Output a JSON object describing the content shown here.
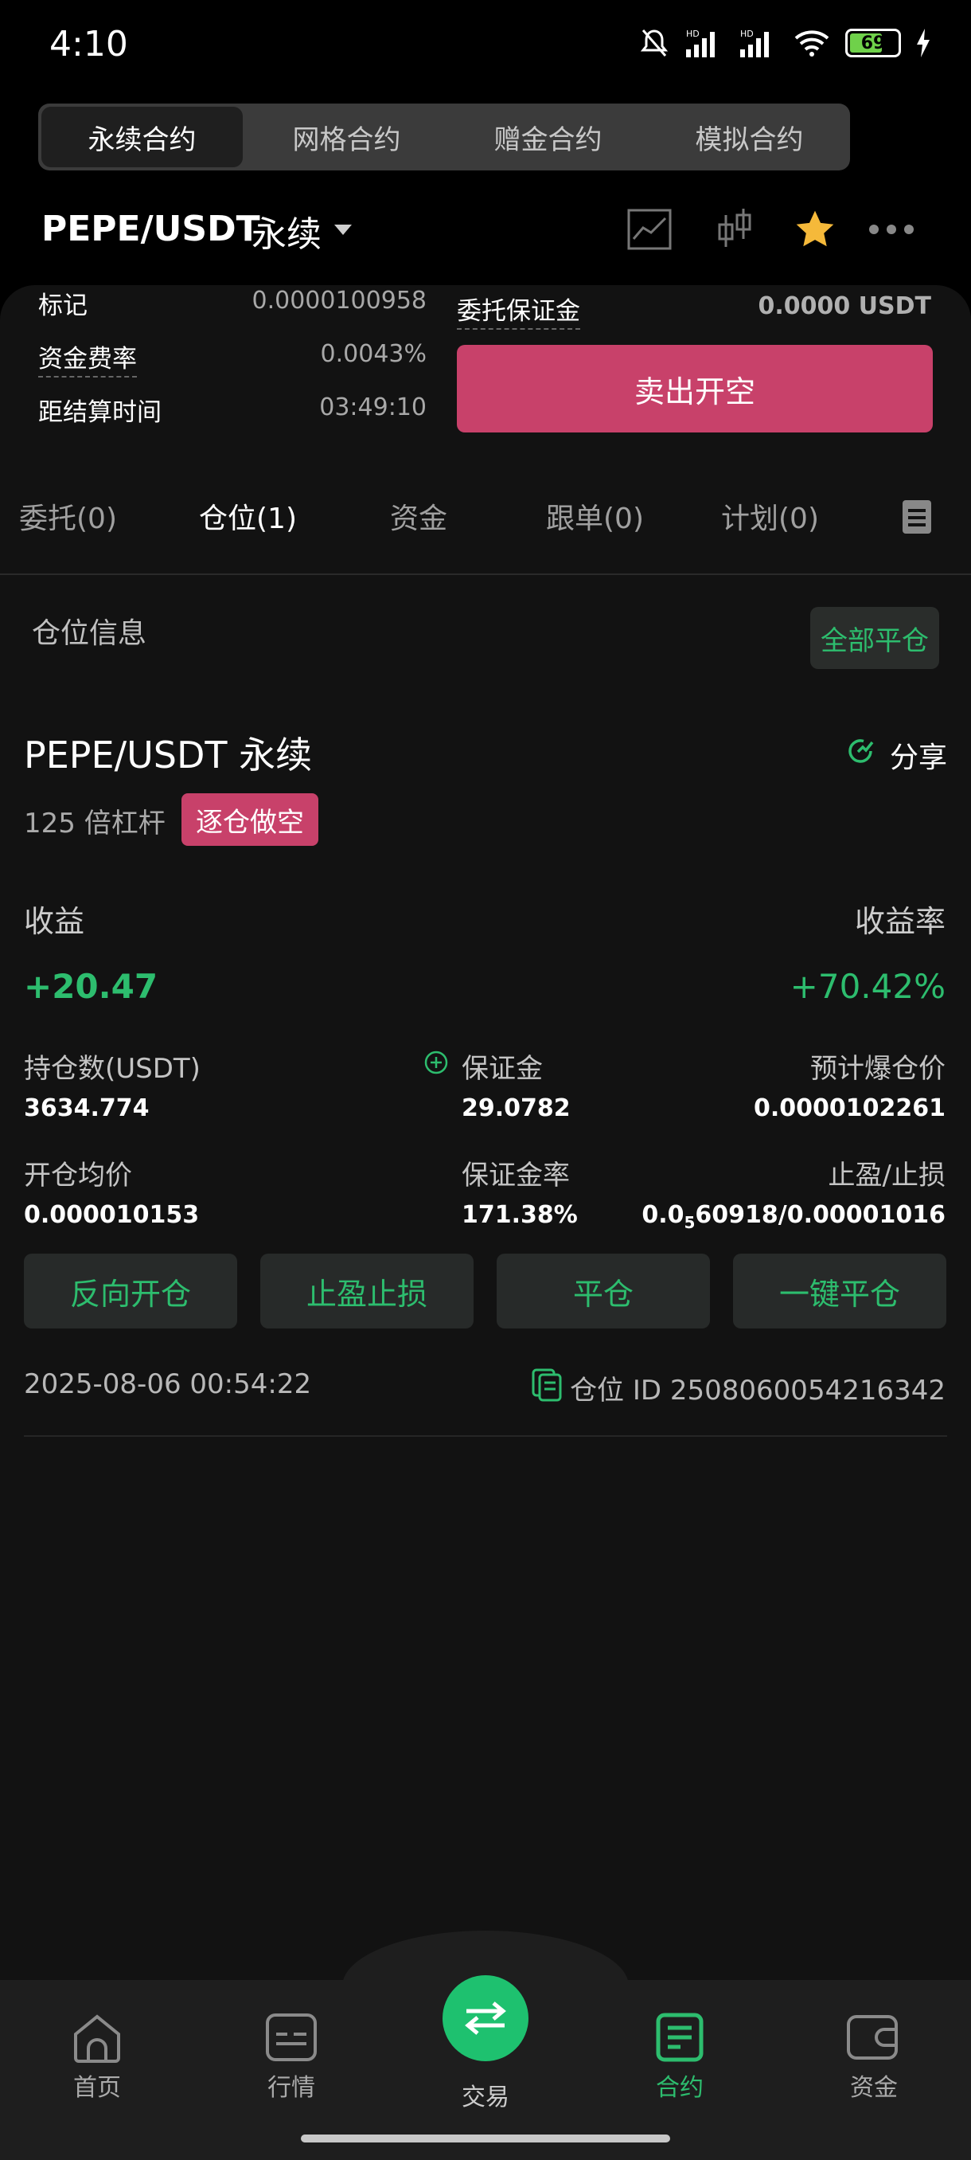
{
  "status_bar": {
    "time": "4:10",
    "battery": "69"
  },
  "segments": [
    "永续合约",
    "网格合约",
    "赠金合约",
    "模拟合约"
  ],
  "header": {
    "pair": "PEPE/USDT",
    "type": "永续"
  },
  "info": {
    "mark_label": "标记",
    "mark_value": "0.0000100958",
    "funding_label": "资金费率",
    "funding_value": "0.0043%",
    "settle_label": "距结算时间",
    "settle_value": "03:49:10",
    "order_margin_label": "委托保证金",
    "order_margin_value": "0.0000 USDT",
    "sell_button": "卖出开空"
  },
  "tabs": [
    "委托(0)",
    "仓位(1)",
    "资金",
    "跟单(0)",
    "计划(0)"
  ],
  "positions": {
    "section_title": "仓位信息",
    "close_all": "全部平仓",
    "title": "PEPE/USDT 永续",
    "share": "分享",
    "leverage": "125 倍杠杆",
    "side": "逐仓做空",
    "pnl_label": "收益",
    "pnl_rate_label": "收益率",
    "pnl_value": "+20.47",
    "pnl_rate_value": "+70.42%",
    "size_label": "持仓数(USDT)",
    "size_value": "3634.774",
    "margin_label": "保证金",
    "margin_value": "29.0782",
    "liq_label": "预计爆仓价",
    "liq_value": "0.0000102261",
    "entry_label": "开仓均价",
    "entry_value": "0.000010153",
    "margin_rate_label": "保证金率",
    "margin_rate_value": "171.38%",
    "tpsl_label": "止盈/止损",
    "tpsl_prefix": "0.0",
    "tpsl_sub": "5",
    "tpsl_rest": "60918/0.00001016",
    "actions": [
      "反向开仓",
      "止盈止损",
      "平仓",
      "一键平仓"
    ],
    "timestamp": "2025-08-06 00:54:22",
    "position_id": "仓位 ID 2508060054216342"
  },
  "nav": {
    "home": "首页",
    "market": "行情",
    "trade": "交易",
    "futures": "合约",
    "assets": "资金"
  },
  "colors": {
    "green": "#2dbd6e",
    "red": "#c8416a",
    "bg": "#121212"
  }
}
